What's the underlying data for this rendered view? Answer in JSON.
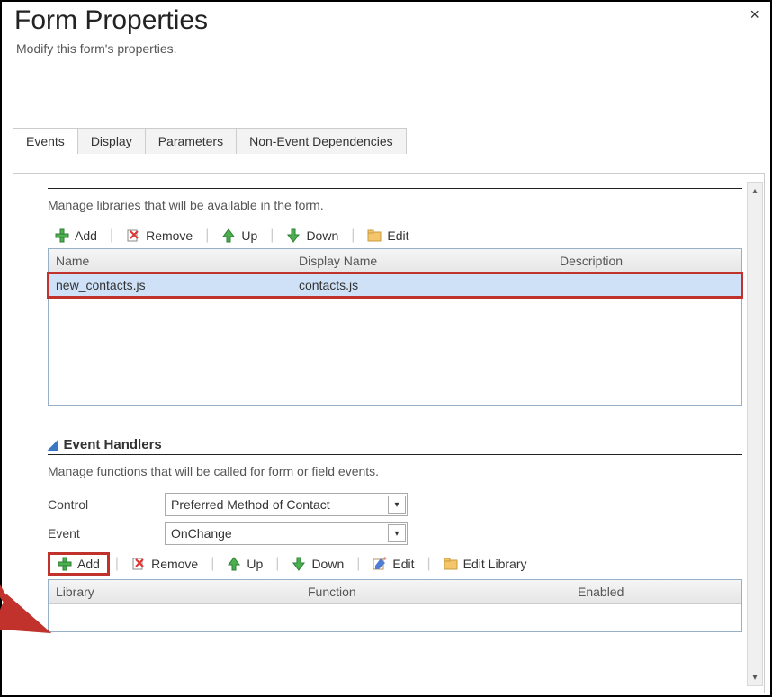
{
  "dialog": {
    "title": "Form Properties",
    "subtitle": "Modify this form's properties.",
    "close": "×"
  },
  "tabs": [
    {
      "label": "Events",
      "active": true
    },
    {
      "label": "Display",
      "active": false
    },
    {
      "label": "Parameters",
      "active": false
    },
    {
      "label": "Non-Event Dependencies",
      "active": false
    }
  ],
  "libraries": {
    "description": "Manage libraries that will be available in the form.",
    "toolbar": {
      "add": "Add",
      "remove": "Remove",
      "up": "Up",
      "down": "Down",
      "edit": "Edit"
    },
    "columns": {
      "name": "Name",
      "display": "Display Name",
      "desc": "Description"
    },
    "rows": [
      {
        "name": "new_contacts.js",
        "display": "contacts.js",
        "desc": ""
      }
    ]
  },
  "handlers": {
    "section_title": "Event Handlers",
    "description": "Manage functions that will be called for form or field events.",
    "control_label": "Control",
    "control_value": "Preferred Method of Contact",
    "event_label": "Event",
    "event_value": "OnChange",
    "toolbar": {
      "add": "Add",
      "remove": "Remove",
      "up": "Up",
      "down": "Down",
      "edit": "Edit",
      "edit_library": "Edit Library"
    },
    "columns": {
      "library": "Library",
      "function": "Function",
      "enabled": "Enabled"
    },
    "rows": []
  }
}
